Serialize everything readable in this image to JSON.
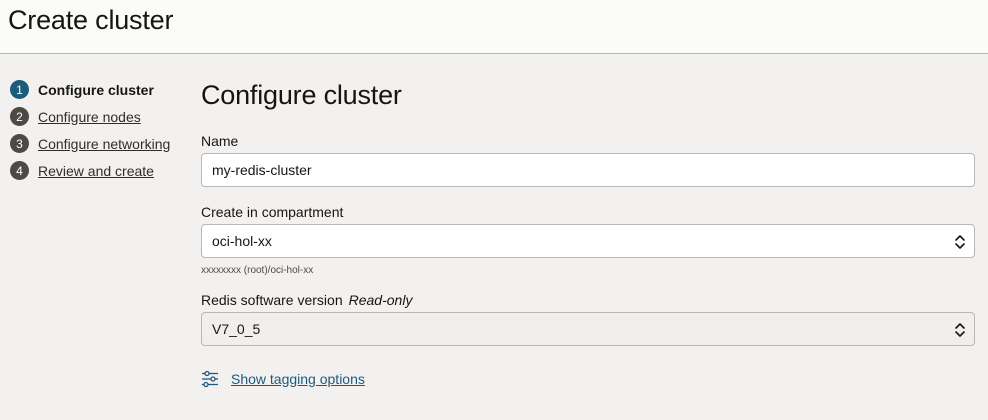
{
  "header": {
    "title": "Create cluster"
  },
  "steps": [
    {
      "number": "1",
      "label": "Configure cluster",
      "active": true
    },
    {
      "number": "2",
      "label": "Configure nodes",
      "active": false
    },
    {
      "number": "3",
      "label": "Configure networking",
      "active": false
    },
    {
      "number": "4",
      "label": "Review and create",
      "active": false
    }
  ],
  "form": {
    "section_title": "Configure cluster",
    "name": {
      "label": "Name",
      "value": "my-redis-cluster"
    },
    "compartment": {
      "label": "Create in compartment",
      "value": "oci-hol-xx",
      "helper": "xxxxxxxx (root)/oci-hol-xx"
    },
    "version": {
      "label": "Redis software version",
      "readonly_label": "Read-only",
      "value": "V7_0_5"
    },
    "tagging_link": "Show tagging options"
  },
  "colors": {
    "accent": "#1c5b7c",
    "step_inactive": "#4d4945",
    "background": "#f2f1f0"
  }
}
